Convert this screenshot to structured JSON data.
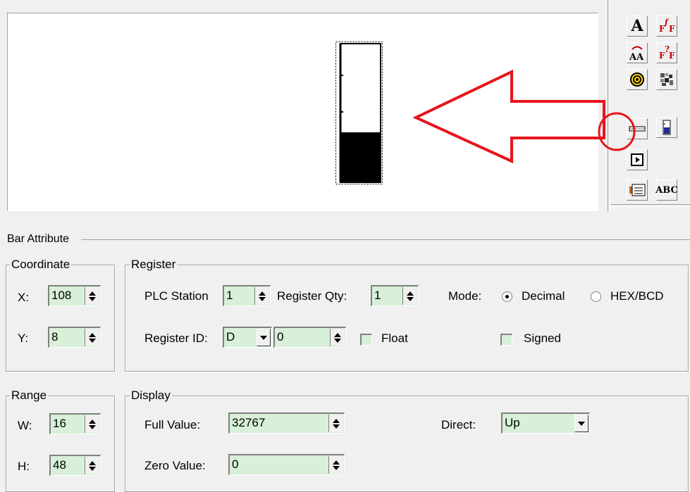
{
  "toolbox": {
    "tools": [
      {
        "name": "text-tool-icon",
        "glyph": "A"
      },
      {
        "name": "format-text-icon",
        "glyph": "F"
      },
      {
        "name": "scroll-text-icon",
        "glyph": "AA"
      },
      {
        "name": "format-text-2-icon",
        "glyph": "F"
      },
      {
        "name": "lamp-icon",
        "glyph": ""
      },
      {
        "name": "image-icon",
        "glyph": ""
      },
      {
        "name": "meter-icon",
        "glyph": ""
      },
      {
        "name": "bar-graph-icon",
        "glyph": ""
      },
      {
        "name": "function-key-icon",
        "glyph": ""
      },
      {
        "name": "message-icon",
        "glyph": ""
      },
      {
        "name": "ascii-icon",
        "glyph": "ABC"
      }
    ]
  },
  "bar_widget": {
    "fill_fraction": 0.36
  },
  "annotation": {
    "arrow_color": "#e8141c",
    "circle_color": "#e8141c"
  },
  "bar_attribute": {
    "title": "Bar Attribute",
    "coordinate": {
      "title": "Coordinate",
      "x_label": "X:",
      "x_value": "108",
      "y_label": "Y:",
      "y_value": "8"
    },
    "register": {
      "title": "Register",
      "plc_station_label": "PLC Station",
      "plc_station_value": "1",
      "register_qty_label": "Register Qty:",
      "register_qty_value": "1",
      "mode_label": "Mode:",
      "mode_decimal": "Decimal",
      "mode_hex": "HEX/BCD",
      "mode_selected": "Decimal",
      "register_id_label": "Register ID:",
      "register_id_type": "D",
      "register_id_value": "0",
      "float_label": "Float",
      "signed_label": "Signed"
    },
    "range": {
      "title": "Range",
      "w_label": "W:",
      "w_value": "16",
      "h_label": "H:",
      "h_value": "48"
    },
    "display": {
      "title": "Display",
      "full_value_label": "Full Value:",
      "full_value": "32767",
      "zero_value_label": "Zero Value:",
      "zero_value": "0",
      "direct_label": "Direct:",
      "direct_value": "Up"
    }
  }
}
